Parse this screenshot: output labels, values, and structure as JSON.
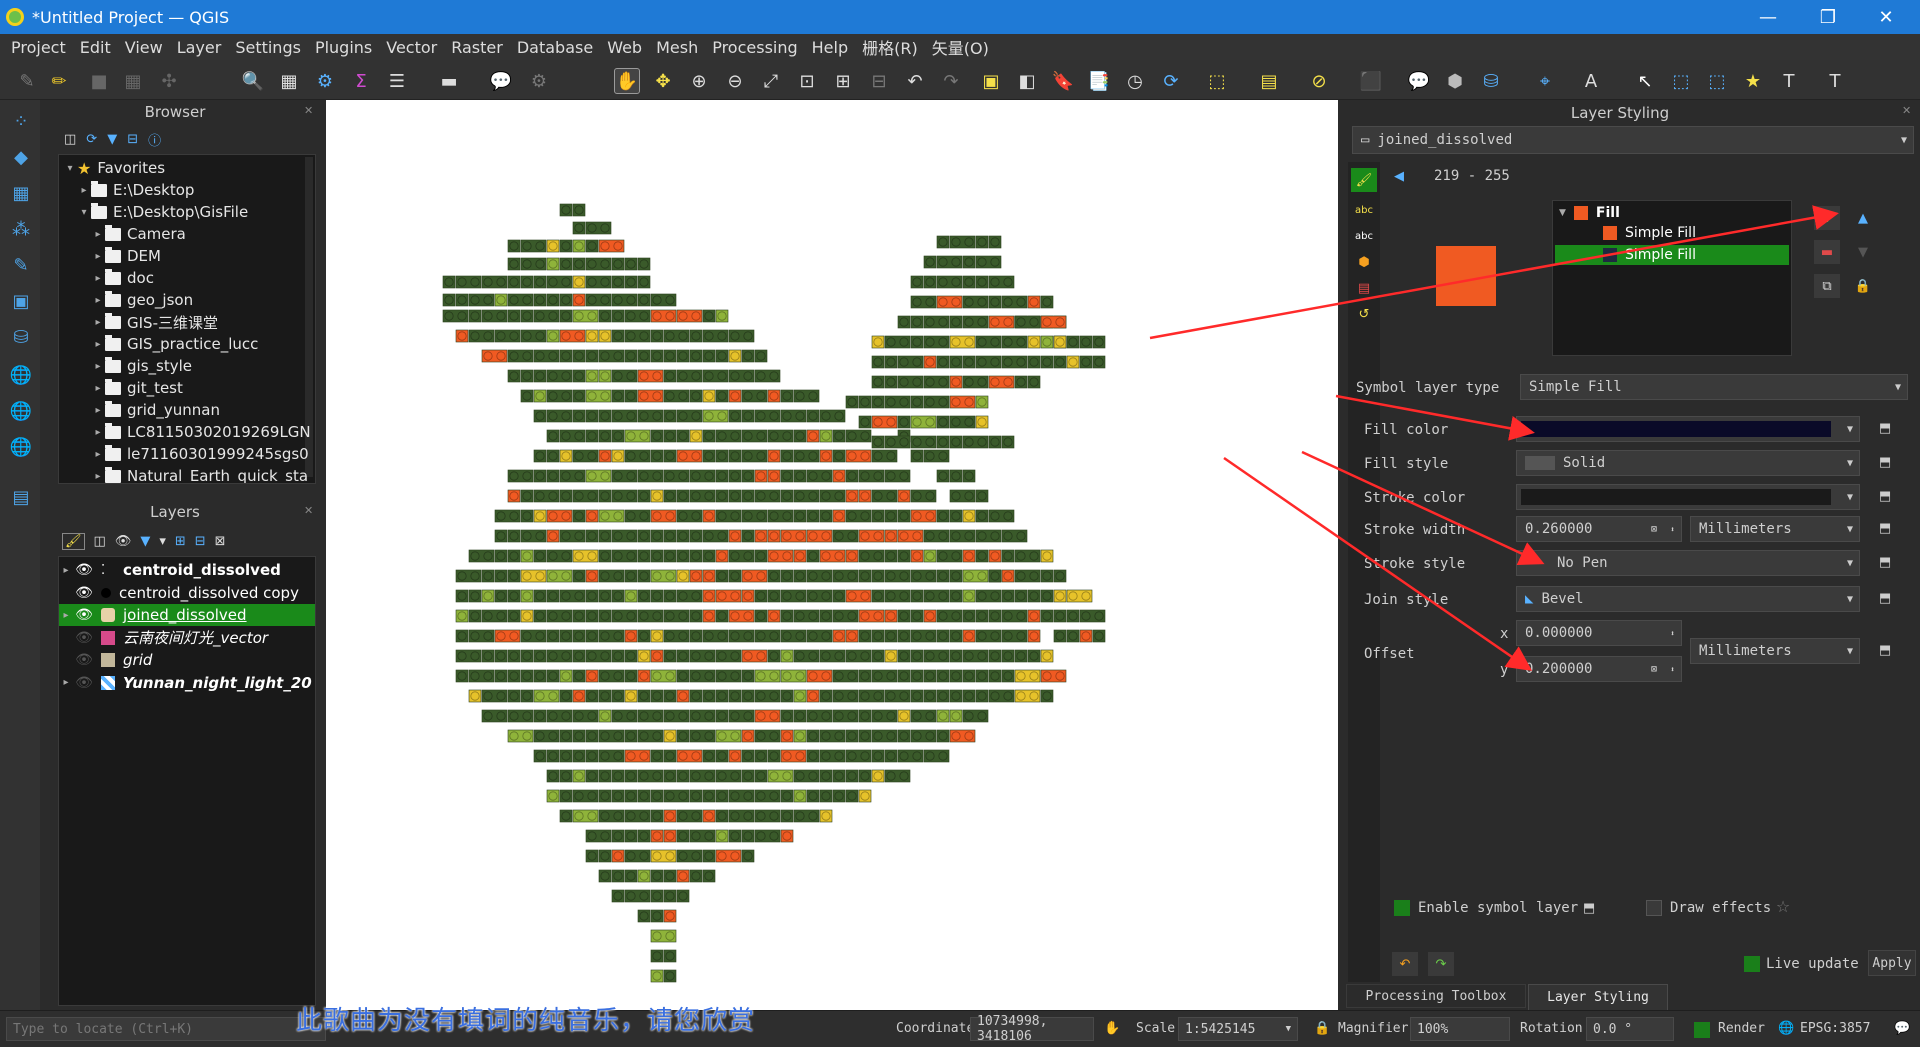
{
  "window": {
    "title": "*Untitled Project — QGIS",
    "minimize": "—",
    "maximize": "❐",
    "close": "✕"
  },
  "menu": [
    "Project",
    "Edit",
    "View",
    "Layer",
    "Settings",
    "Plugins",
    "Vector",
    "Raster",
    "Database",
    "Web",
    "Mesh",
    "Processing",
    "Help",
    "栅格(R)",
    "矢量(O)"
  ],
  "browser": {
    "title": "Browser",
    "items": [
      {
        "label": "Favorites",
        "type": "star",
        "level": 0,
        "expanded": true
      },
      {
        "label": "E:\\Desktop",
        "type": "folder",
        "level": 1
      },
      {
        "label": "E:\\Desktop\\GisFile",
        "type": "folder",
        "level": 1,
        "expanded": true
      },
      {
        "label": "Camera",
        "type": "folder",
        "level": 2
      },
      {
        "label": "DEM",
        "type": "folder",
        "level": 2
      },
      {
        "label": "doc",
        "type": "folder",
        "level": 2
      },
      {
        "label": "geo_json",
        "type": "folder",
        "level": 2
      },
      {
        "label": "GIS-三维课堂",
        "type": "folder",
        "level": 2
      },
      {
        "label": "GIS_practice_lucc",
        "type": "folder",
        "level": 2
      },
      {
        "label": "gis_style",
        "type": "folder",
        "level": 2
      },
      {
        "label": "git_test",
        "type": "folder",
        "level": 2
      },
      {
        "label": "grid_yunnan",
        "type": "folder",
        "level": 2
      },
      {
        "label": "LC81150302019269LGN",
        "type": "folder",
        "level": 2
      },
      {
        "label": "le71160301999245sgs0",
        "type": "folder",
        "level": 2
      },
      {
        "label": "Natural_Earth_quick_sta",
        "type": "folder",
        "level": 2
      }
    ]
  },
  "layers": {
    "title": "Layers",
    "items": [
      {
        "label": "centroid_dissolved",
        "visible": true,
        "bold": true,
        "italic": false,
        "symbol": "points",
        "selected": false
      },
      {
        "label": "centroid_dissolved copy",
        "visible": true,
        "bold": false,
        "italic": false,
        "symbol": "dot",
        "selected": false
      },
      {
        "label": "joined_dissolved",
        "visible": true,
        "bold": false,
        "italic": false,
        "symbol": "lego",
        "selected": true
      },
      {
        "label": "云南夜间灯光_vector",
        "visible": false,
        "bold": false,
        "italic": true,
        "symbol": "#d64a8a",
        "selected": false
      },
      {
        "label": "grid",
        "visible": false,
        "bold": false,
        "italic": true,
        "symbol": "#c2b79a",
        "selected": false
      },
      {
        "label": "Yunnan_night_light_20",
        "visible": false,
        "bold": true,
        "italic": true,
        "symbol": "raster",
        "selected": false
      }
    ]
  },
  "styling": {
    "title": "Layer Styling",
    "layer_combo": "joined_dissolved",
    "range": "219 - 255",
    "tree": {
      "root": "Fill",
      "children": [
        "Simple Fill",
        "Simple Fill"
      ]
    },
    "preview_color": "#f05a22",
    "symbol_layer_type_label": "Symbol layer type",
    "symbol_layer_type": "Simple Fill",
    "fill_color_label": "Fill color",
    "fill_style_label": "Fill style",
    "fill_style": "Solid",
    "stroke_color_label": "Stroke color",
    "stroke_width_label": "Stroke width",
    "stroke_width": "0.260000",
    "stroke_width_unit": "Millimeters",
    "stroke_style_label": "Stroke style",
    "stroke_style": "No Pen",
    "join_style_label": "Join style",
    "join_style": "Bevel",
    "offset_label": "Offset",
    "offset_x_label": "x",
    "offset_x": "0.000000",
    "offset_y_label": "y",
    "offset_y": "0.200000",
    "offset_unit": "Millimeters",
    "enable_symbol_layer": "Enable symbol layer",
    "draw_effects": "Draw effects",
    "live_update": "Live update",
    "apply": "Apply",
    "tabs": [
      "Processing Toolbox",
      "Layer Styling"
    ]
  },
  "status": {
    "locate_placeholder": "Type to locate (Ctrl+K)",
    "coordinate_label": "Coordinate",
    "coordinate": "10734998, 3418106",
    "scale_label": "Scale",
    "scale": "1:5425145",
    "magnifier_label": "Magnifier",
    "magnifier": "100%",
    "rotation_label": "Rotation",
    "rotation": "0.0 °",
    "render_label": "Render",
    "crs": "EPSG:3857"
  },
  "subtitle": "此歌曲为没有填词的纯音乐，请您欣赏",
  "colors": {
    "dark_green": "#3a5a2a",
    "orange": "#f05a22",
    "yellow": "#e6c22a",
    "light_green": "#8fb33a",
    "selection_green": "#1a8a1a"
  }
}
